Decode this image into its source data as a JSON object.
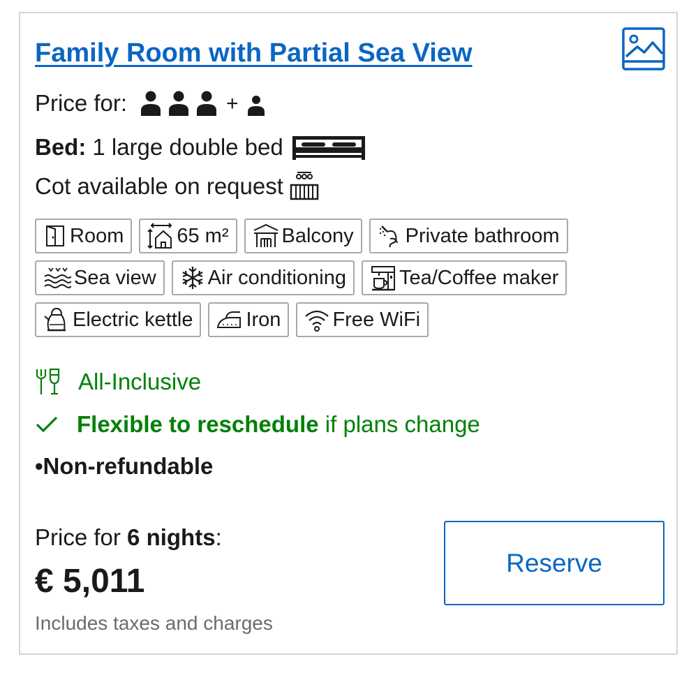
{
  "room": {
    "title": "Family Room with Partial Sea View",
    "price_for_label": "Price for:",
    "occupancy": {
      "adults": 3,
      "children": 1,
      "plus": "+"
    },
    "bed_label": "Bed:",
    "bed_value": "1 large double bed",
    "cot_text": "Cot available on request"
  },
  "facilities": [
    {
      "icon": "door-icon",
      "label": "Room"
    },
    {
      "icon": "room-size-icon",
      "label": "65 m²"
    },
    {
      "icon": "balcony-icon",
      "label": "Balcony"
    },
    {
      "icon": "shower-icon",
      "label": "Private bathroom"
    },
    {
      "icon": "sea-view-icon",
      "label": "Sea view"
    },
    {
      "icon": "snowflake-icon",
      "label": "Air conditioning"
    },
    {
      "icon": "coffee-maker-icon",
      "label": "Tea/Coffee maker"
    },
    {
      "icon": "kettle-icon",
      "label": "Electric kettle"
    },
    {
      "icon": "iron-icon",
      "label": "Iron"
    },
    {
      "icon": "wifi-icon",
      "label": "Free WiFi"
    }
  ],
  "policies": {
    "meal": "All-Inclusive",
    "flexible_bold": "Flexible to reschedule",
    "flexible_rest": " if plans change",
    "non_refundable": "•Non-refundable"
  },
  "pricing": {
    "label_prefix": "Price for ",
    "nights": "6 nights",
    "label_suffix": ":",
    "amount": "€ 5,011",
    "taxes_note": "Includes taxes and charges"
  },
  "actions": {
    "reserve_label": "Reserve"
  },
  "colors": {
    "link_blue": "#0a66c2",
    "success_green": "#008009",
    "muted_grey": "#6b6b6b",
    "border_grey": "#a8a8a8"
  }
}
